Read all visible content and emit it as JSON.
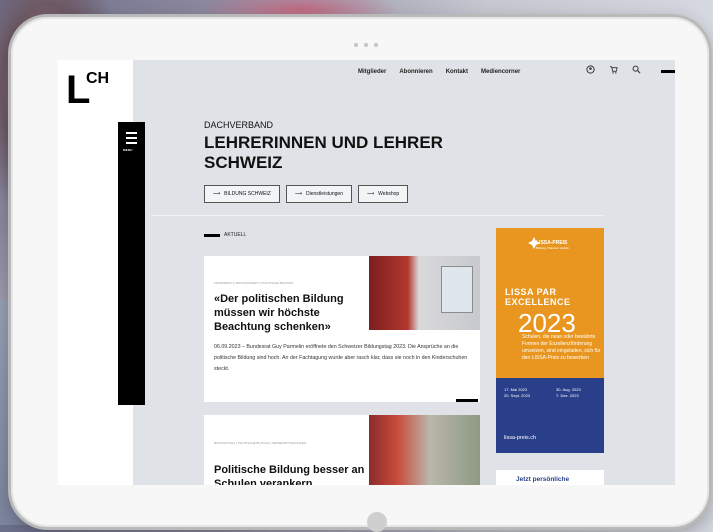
{
  "logo": {
    "letter": "L",
    "superscript": "CH"
  },
  "nav": {
    "items": [
      "Mitglieder",
      "Abonnieren",
      "Kontakt",
      "Mediencorner"
    ]
  },
  "icons": [
    "account-icon",
    "cart-icon",
    "search-icon"
  ],
  "menu": {
    "label": "MENU"
  },
  "hero": {
    "kicker": "DACHVERBAND",
    "headline": "LEHRERINNEN UND LEHRER SCHWEIZ",
    "buttons": [
      "BILDUNG SCHWEIZ",
      "Dienstleistungen",
      "Webshop"
    ]
  },
  "section": {
    "label": "AKTUELL"
  },
  "articles": [
    {
      "category": "FRANKREICH | BILDUNGSHEFT | POLITISCHE BILDUNG",
      "title": "«Der politischen Bildung müssen wir höchste Beachtung schenken»",
      "body": "06.09.2023 – Bundesrat Guy Parmelin eröffnete den Schweizer Bildungstag 2023. Die Ansprüche an die politische Bildung sind hoch. An der Fachtagung wurde aber rasch klar, dass sie noch in den Kinderschuhen steckt."
    },
    {
      "category": "BILDUNGSTAG | POLITISCHE BILDUNG | MEDIENMITTEILUNGEN",
      "title": "Politische Bildung besser an Schulen verankern"
    }
  ],
  "ad": {
    "brand": "LISSA-PREIS",
    "brand_sub": "Bildung Chancen Vielfalt",
    "line1": "LISSA PAR",
    "line2": "EXCELLENCE",
    "year": "2023",
    "text": "Schulen, die neue oder bewährte Formen der Exzellenzförderung umsetzen, sind eingeladen, sich für den LISSA-Preis zu bewerben",
    "date1": "17. Mai 2023",
    "date2": "20. Sept. 2023",
    "date3": "30. Aug. 2023",
    "date4": "7. Dez. 2023",
    "url": "lissa-preis.ch"
  },
  "promo": {
    "title": "Jetzt persönliche"
  }
}
